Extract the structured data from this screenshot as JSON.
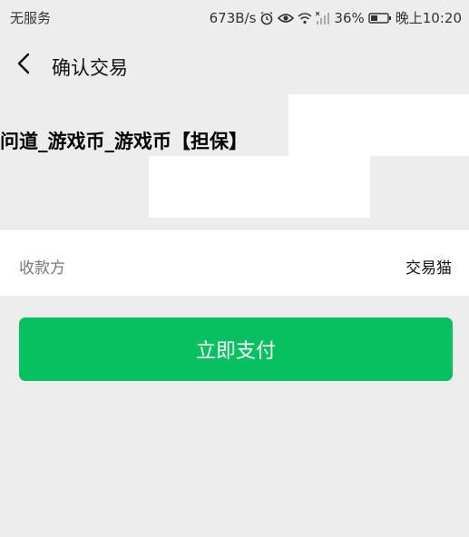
{
  "status_bar": {
    "carrier": "无服务",
    "net_speed": "673B/s",
    "battery": "36%",
    "time": "晚上10:20",
    "icons": [
      "alarm-icon",
      "eye-icon",
      "wifi-icon",
      "signal-icon",
      "battery-icon"
    ]
  },
  "nav": {
    "back_icon": "chevron-left-icon",
    "title": "确认交易"
  },
  "product": {
    "title": "问道_游戏币_游戏币【担保】"
  },
  "payee": {
    "label": "收款方",
    "value": "交易猫"
  },
  "pay_button": {
    "label": "立即支付"
  },
  "colors": {
    "background": "#ededed",
    "card": "#ffffff",
    "primary_green": "#07c160"
  }
}
